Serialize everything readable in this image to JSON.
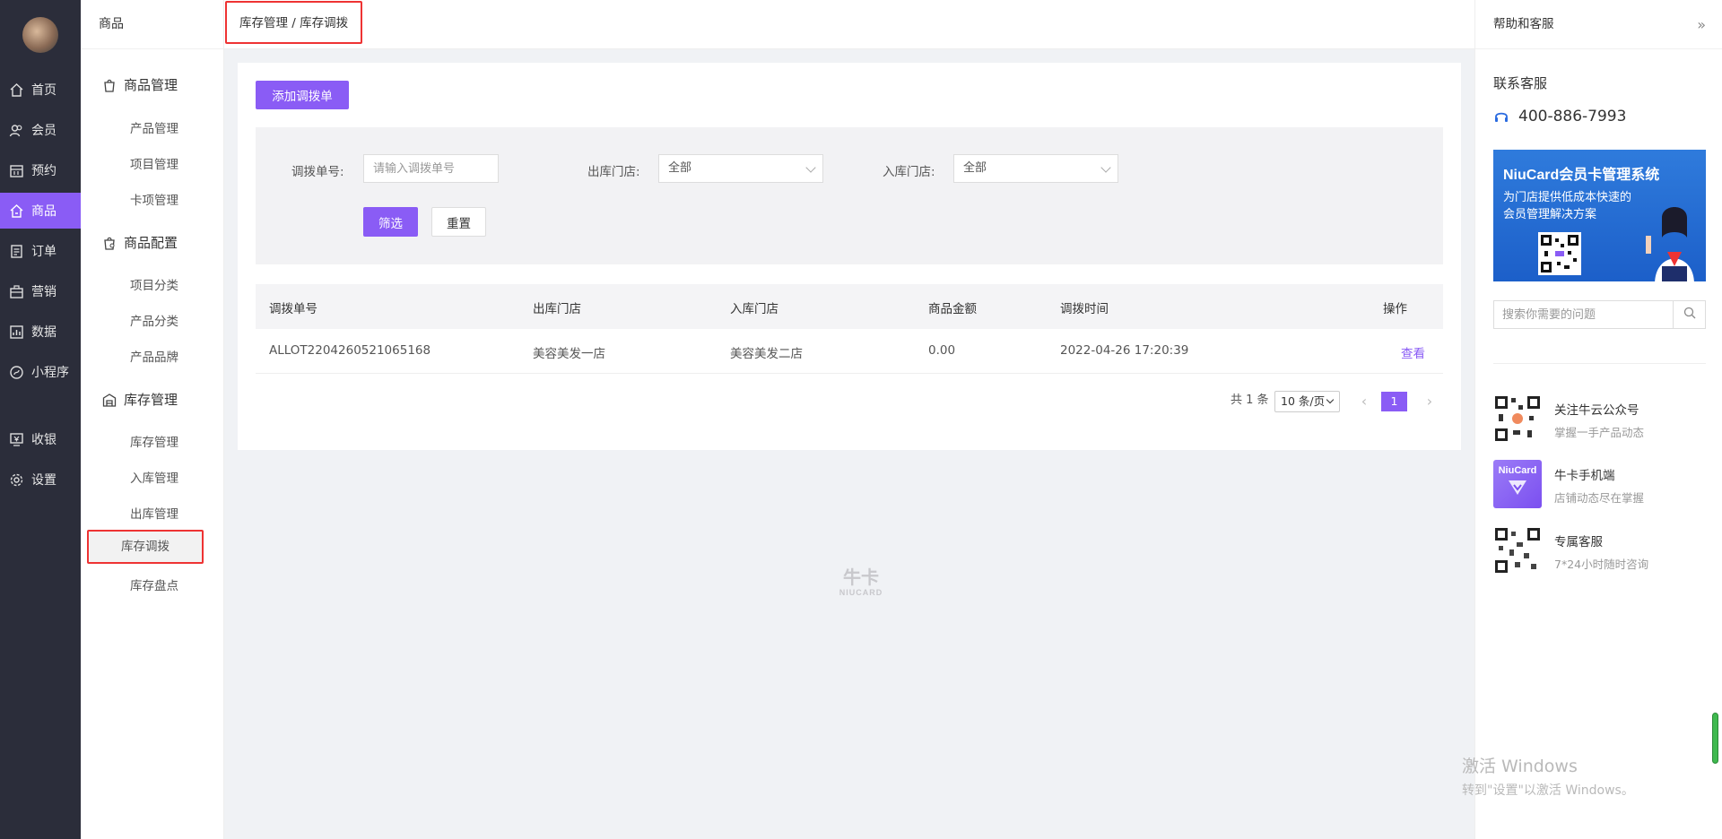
{
  "nav": {
    "items": [
      {
        "label": "首页",
        "icon": "home-icon"
      },
      {
        "label": "会员",
        "icon": "members-icon"
      },
      {
        "label": "预约",
        "icon": "calendar-icon"
      },
      {
        "label": "商品",
        "icon": "goods-icon",
        "active": true
      },
      {
        "label": "订单",
        "icon": "order-icon"
      },
      {
        "label": "营销",
        "icon": "marketing-icon"
      },
      {
        "label": "数据",
        "icon": "chart-icon"
      },
      {
        "label": "小程序",
        "icon": "miniprogram-icon"
      },
      {
        "label": "收银",
        "icon": "cashier-icon"
      },
      {
        "label": "设置",
        "icon": "gear-icon"
      }
    ]
  },
  "subnav": {
    "title": "商品",
    "groups": [
      {
        "title": "商品管理",
        "items": [
          "产品管理",
          "项目管理",
          "卡项管理"
        ]
      },
      {
        "title": "商品配置",
        "items": [
          "项目分类",
          "产品分类",
          "产品品牌"
        ]
      },
      {
        "title": "库存管理",
        "items": [
          "库存管理",
          "入库管理",
          "出库管理",
          "库存调拨",
          "库存盘点"
        ]
      }
    ],
    "active_item": "库存调拨"
  },
  "breadcrumb": "库存管理 / 库存调拨",
  "main": {
    "add_button": "添加调拨单",
    "filters": {
      "order_no_label": "调拨单号:",
      "order_no_placeholder": "请输入调拨单号",
      "out_store_label": "出库门店:",
      "out_store_value": "全部",
      "in_store_label": "入库门店:",
      "in_store_value": "全部",
      "filter_button": "筛选",
      "reset_button": "重置"
    },
    "table": {
      "columns": [
        "调拨单号",
        "出库门店",
        "入库门店",
        "商品金额",
        "调拨时间",
        "操作"
      ],
      "rows": [
        [
          "ALLOT2204260521065168",
          "美容美发一店",
          "美容美发二店",
          "0.00",
          "2022-04-26 17:20:39",
          "查看"
        ]
      ]
    },
    "pagination": {
      "total_text": "共 1 条",
      "page_size": "10 条/页",
      "current_page": "1"
    }
  },
  "watermark": {
    "logo_text": "牛卡",
    "logo_sub": "NIUCARD"
  },
  "help": {
    "title": "帮助和客服",
    "contact_title": "联系客服",
    "phone": "400-886-7993",
    "banner": {
      "title": "NiuCard会员卡管理系统",
      "subtitle": "为门店提供低成本快速的会员管理解决方案"
    },
    "search_placeholder": "搜索你需要的问题",
    "items": [
      {
        "title": "关注牛云公众号",
        "desc": "掌握一手产品动态"
      },
      {
        "title": "牛卡手机端",
        "desc": "店铺动态尽在掌握",
        "thumb_text": "NiuCard"
      },
      {
        "title": "专属客服",
        "desc": "7*24小时随时咨询"
      }
    ]
  },
  "windows_activation": {
    "line1": "激活 Windows",
    "line2": "转到\"设置\"以激活 Windows。"
  },
  "colors": {
    "accent": "#8a5cf5",
    "nav_bg": "#2b2d3a",
    "highlight_border": "#e33333"
  }
}
